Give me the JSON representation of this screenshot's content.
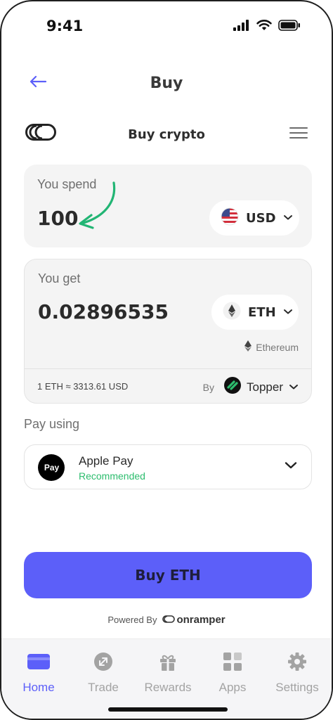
{
  "status_bar": {
    "time": "9:41"
  },
  "header": {
    "title": "Buy"
  },
  "section": {
    "title": "Buy crypto"
  },
  "spend": {
    "label": "You spend",
    "amount": "100",
    "currency": "USD"
  },
  "get": {
    "label": "You get",
    "amount": "0.02896535",
    "currency": "ETH",
    "network": "Ethereum",
    "rate": "1 ETH ≈ 3313.61 USD",
    "by_label": "By",
    "provider": "Topper"
  },
  "payment": {
    "label": "Pay using",
    "method": "Apple Pay",
    "method_logo_text": "Pay",
    "recommended": "Recommended"
  },
  "buy_button": {
    "label": "Buy ETH"
  },
  "powered_by": {
    "label": "Powered By",
    "brand": "onramper"
  },
  "tabs": [
    {
      "label": "Home",
      "icon": "card-icon",
      "active": true
    },
    {
      "label": "Trade",
      "icon": "trade-icon",
      "active": false
    },
    {
      "label": "Rewards",
      "icon": "gift-icon",
      "active": false
    },
    {
      "label": "Apps",
      "icon": "apps-grid-icon",
      "active": false
    },
    {
      "label": "Settings",
      "icon": "gear-icon",
      "active": false
    }
  ],
  "colors": {
    "accent": "#5c5ff9",
    "annotation_arrow": "#22b574",
    "recommended": "#2dbd6e",
    "inactive_tab": "#a3a3a3"
  }
}
